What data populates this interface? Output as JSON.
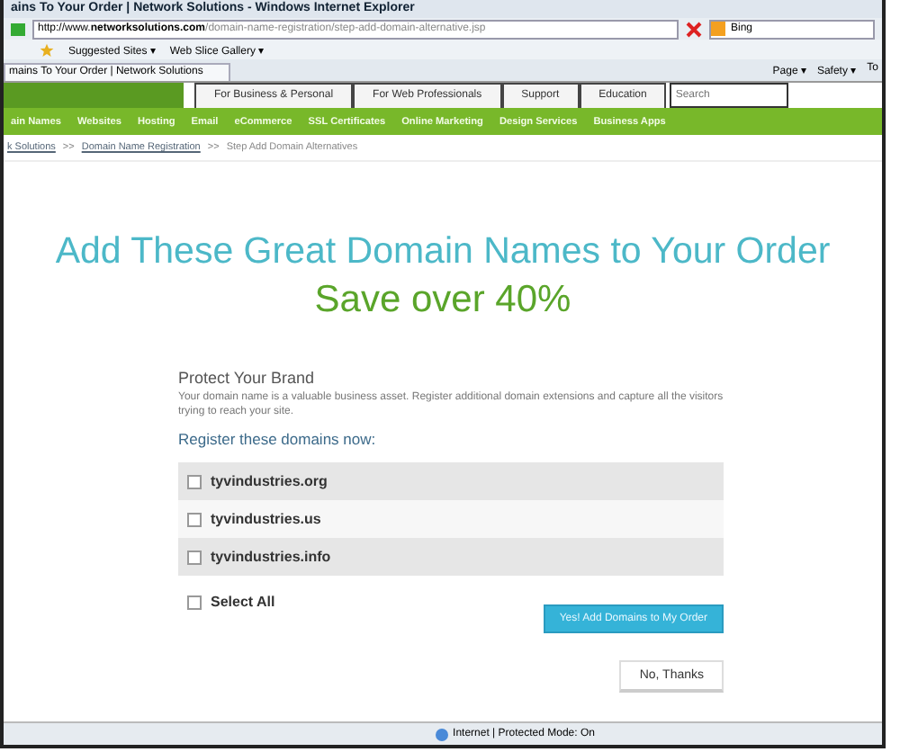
{
  "window": {
    "title": "ains To Your Order | Network Solutions - Windows Internet Explorer"
  },
  "address_bar": {
    "url_prefix": "http://www.",
    "url_domain": "networksolutions.com",
    "url_path": "/domain-name-registration/step-add-domain-alternative.jsp",
    "search_value": "Bing"
  },
  "favorites_bar": [
    "Suggested Sites ▾",
    "Web Slice Gallery ▾"
  ],
  "browser_tab": {
    "title": "mains To Your Order | Network Solutions"
  },
  "command_bar": [
    "Page ▾",
    "Safety ▾",
    "To"
  ],
  "site_tabs": [
    {
      "label": "For Business & Personal",
      "selected": false
    },
    {
      "label": "For Web Professionals",
      "selected": false
    },
    {
      "label": "Support",
      "selected": false
    },
    {
      "label": "Education",
      "selected": false
    }
  ],
  "site_search": {
    "placeholder": "Search"
  },
  "menu": [
    "ain Names",
    "Websites",
    "Hosting",
    "Email",
    "eCommerce",
    "SSL Certificates",
    "Online Marketing",
    "Design Services",
    "Business Apps"
  ],
  "breadcrumb": [
    {
      "label": "k Solutions",
      "kind": "link"
    },
    {
      "label": ">>",
      "kind": "sep"
    },
    {
      "label": "Domain Name Registration",
      "kind": "link"
    },
    {
      "label": ">>",
      "kind": "sep"
    },
    {
      "label": "Step Add Domain Alternatives",
      "kind": "text"
    }
  ],
  "heading": "Add These Great Domain Names to Your Order",
  "subheading": "Save over 40%",
  "protect": {
    "title": "Protect Your Brand",
    "text": "Your domain name is a valuable business asset. Register additional domain extensions and capture all the visitors trying to reach your site."
  },
  "register_label": "Register these domains now:",
  "domains": [
    {
      "name": "tyvindustries.org",
      "checked": false
    },
    {
      "name": "tyvindustries.us",
      "checked": false
    },
    {
      "name": "tyvindustries.info",
      "checked": false
    }
  ],
  "select_all": {
    "label": "Select All",
    "checked": false
  },
  "add_button": "Yes! Add Domains to My Order",
  "no_button": "No, Thanks",
  "status_bar": {
    "zone": "Internet | Protected Mode: On"
  }
}
